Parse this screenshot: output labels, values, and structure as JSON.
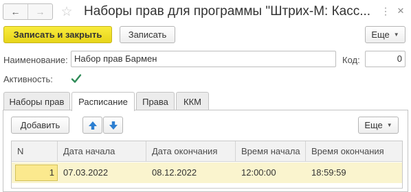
{
  "window": {
    "title": "Наборы прав для программы \"Штрих-М: Касс...",
    "back_icon": "←",
    "forward_icon": "→",
    "star_icon": "☆",
    "menu_icon": "⋮",
    "close_icon": "×"
  },
  "toolbar": {
    "save_close_label": "Записать и закрыть",
    "save_label": "Записать",
    "more_label": "Еще"
  },
  "form": {
    "name_label": "Наименование:",
    "name_value": "Набор прав Бармен",
    "code_label": "Код:",
    "code_value": "0",
    "active_label": "Активность:",
    "active_checked": true
  },
  "tabs": [
    {
      "label": "Наборы прав",
      "active": false
    },
    {
      "label": "Расписание",
      "active": true
    },
    {
      "label": "Права",
      "active": false
    },
    {
      "label": "ККМ",
      "active": false
    }
  ],
  "schedule": {
    "add_label": "Добавить",
    "up_icon": "arrow-up-icon",
    "down_icon": "arrow-down-icon",
    "more_label": "Еще",
    "columns": [
      "N",
      "Дата начала",
      "Дата окончания",
      "Время начала",
      "Время окончания"
    ],
    "rows": [
      [
        "1",
        "07.03.2022",
        "08.12.2022",
        "12:00:00",
        "18:59:59"
      ]
    ]
  },
  "colors": {
    "primary_button": "#f3e22c",
    "selected_row": "#faf4ce",
    "arrow_blue": "#2d7fd1",
    "checkmark": "#2e8b57"
  }
}
